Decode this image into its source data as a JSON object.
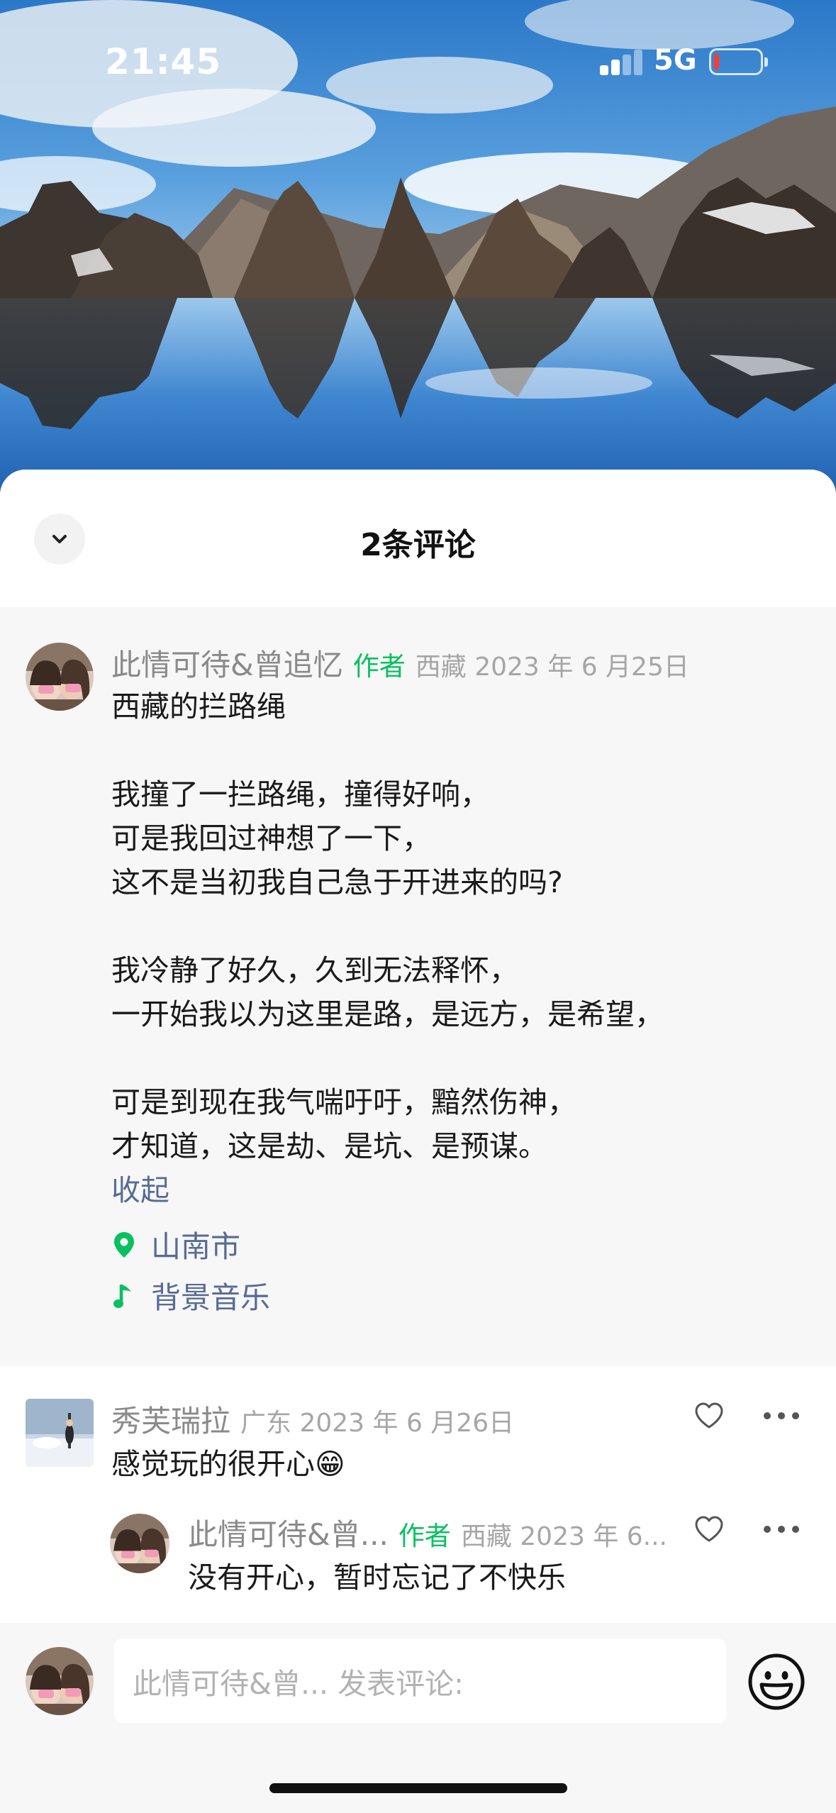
{
  "status_bar": {
    "time": "21:45",
    "network": "5G",
    "battery_level": 0.08
  },
  "sheet": {
    "title": "2条评论",
    "collapse_icon": "chevron-down-icon"
  },
  "post": {
    "author": "此情可待&曾追忆",
    "author_tag": "作者",
    "meta": "西藏 2023 年 6 月25日",
    "title": "西藏的拦路绳",
    "lines": [
      "我撞了一拦路绳，撞得好响，",
      "可是我回过神想了一下，",
      "这不是当初我自己急于开进来的吗?",
      "我冷静了好久，久到无法释怀，",
      "一开始我以为这里是路，是远方，是希望，",
      "可是到现在我气喘吁吁，黯然伤神，",
      "才知道，这是劫、是坑、是预谋。"
    ],
    "collapse_label": "收起",
    "location": "山南市",
    "music": "背景音乐"
  },
  "comments": [
    {
      "user": "秀芙瑞拉",
      "meta": "广东 2023 年 6 月26日",
      "text": "感觉玩的很开心😁"
    },
    {
      "user": "此情可待&曾...",
      "tag": "作者",
      "meta": "西藏 2023 年 6...",
      "text": "没有开心，暂时忘记了不快乐"
    }
  ],
  "composer": {
    "placeholder": "此情可待&曾... 发表评论:"
  },
  "colors": {
    "accent_green": "#07c160",
    "link_blue": "#576b95",
    "meta_gray": "#a6a6a6"
  }
}
